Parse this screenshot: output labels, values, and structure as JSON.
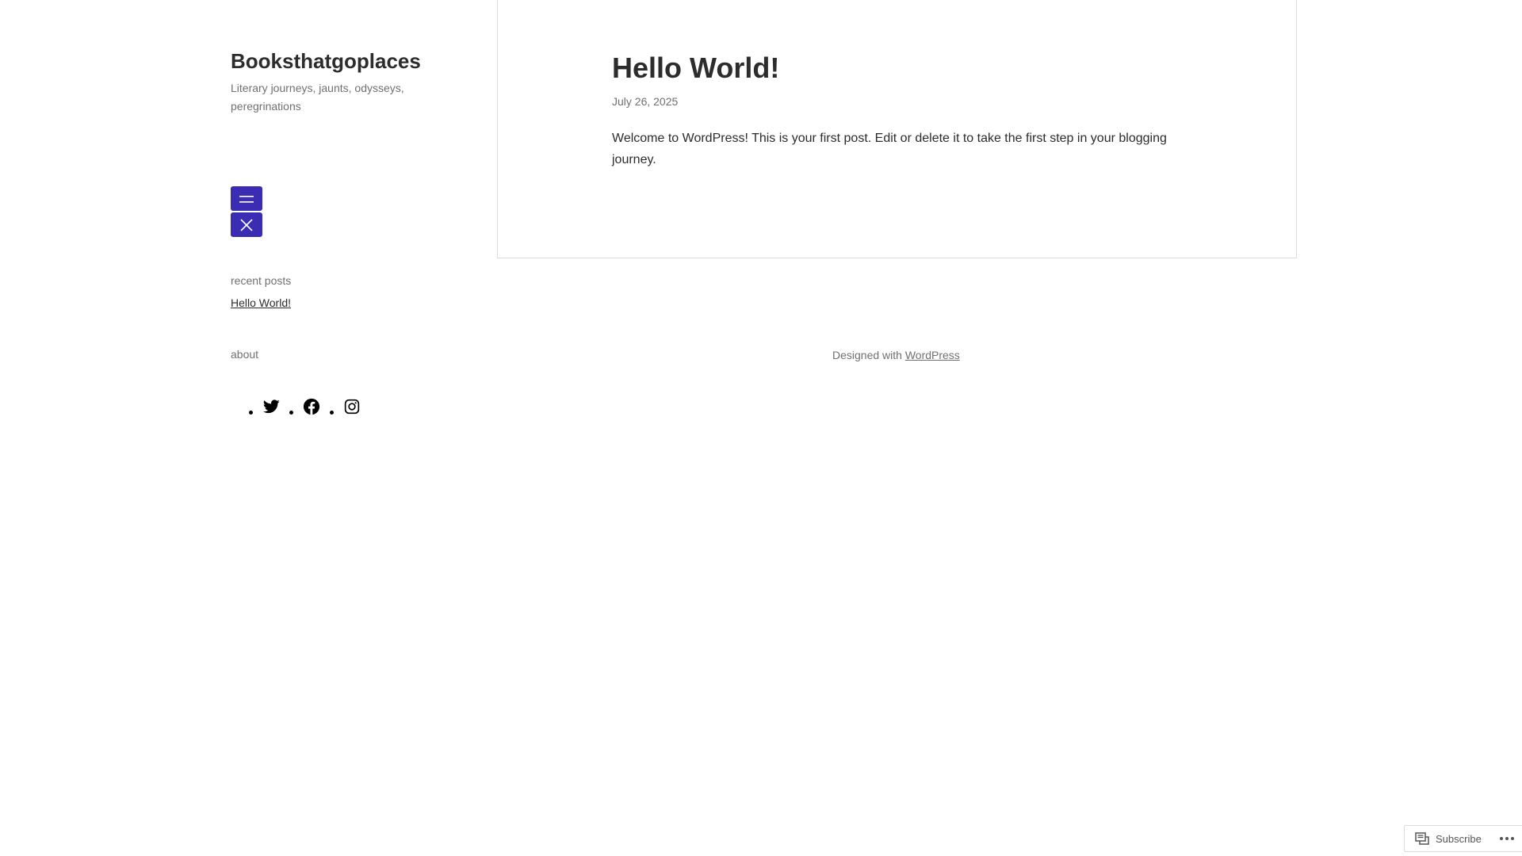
{
  "site": {
    "title": "Booksthatgoplaces",
    "description": "Literary journeys, jaunts, odysseys, peregrinations"
  },
  "nav": {
    "open_icon": "hamburger-menu-icon",
    "close_icon": "close-icon",
    "accent_color": "#3b2cb4"
  },
  "widgets": {
    "recent_title": "recent posts",
    "recent_posts": [
      "Hello World!"
    ],
    "about_title": "about"
  },
  "social": {
    "icons": [
      "twitter-icon",
      "facebook-icon",
      "instagram-icon"
    ]
  },
  "post": {
    "title": "Hello World!",
    "date": "July 26, 2025",
    "body": "Welcome to WordPress! This is your first post. Edit or delete it to take the first step in your blogging journey."
  },
  "footer": {
    "prefix": "Designed with",
    "link": "WordPress"
  },
  "subscribe_bar": {
    "label": "Subscribe",
    "icon": "reader-icon",
    "more_icon": "ellipsis-icon"
  }
}
